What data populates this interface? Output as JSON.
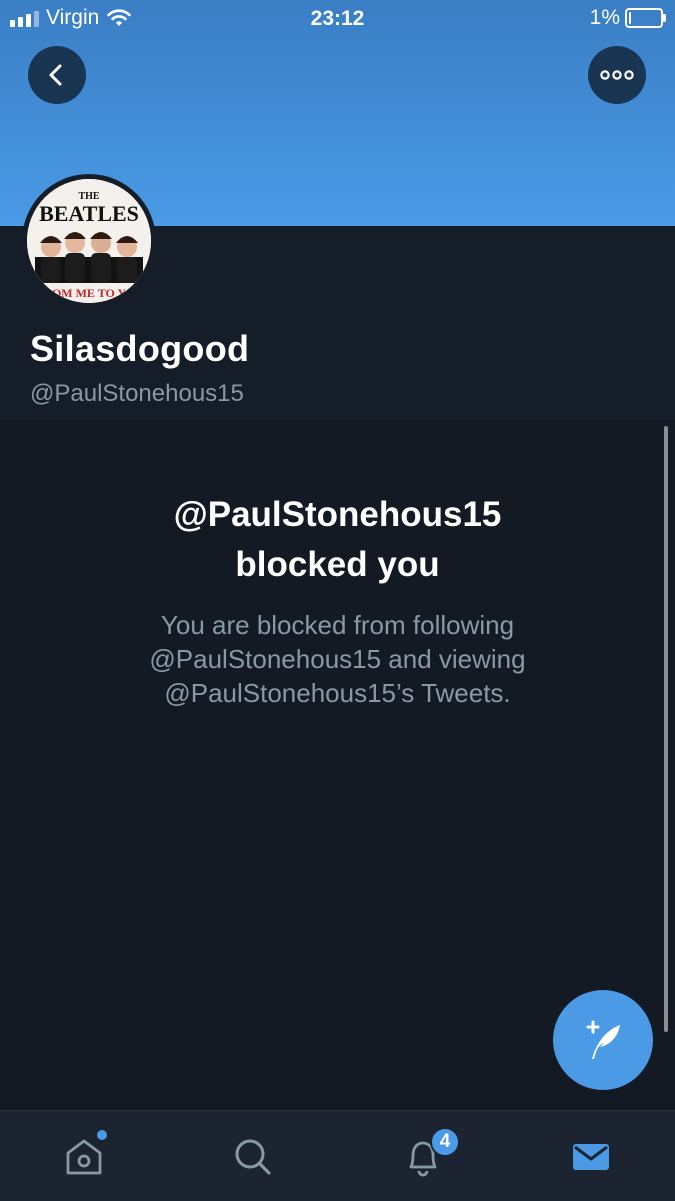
{
  "status_bar": {
    "carrier": "Virgin",
    "time": "23:12",
    "battery_percent": "1%"
  },
  "header": {
    "back_icon": "chevron-left-icon",
    "more_icon": "more-horizontal-icon"
  },
  "profile": {
    "display_name": "Silasdogood",
    "handle": "@PaulStonehous15",
    "avatar": {
      "title": "THE BEATLES",
      "subtitle": "OM ME TO Y"
    }
  },
  "blocked": {
    "title_line1": "@PaulStonehous15",
    "title_line2": "blocked you",
    "desc_line1": "You are blocked from following",
    "desc_line2": "@PaulStonehous15 and viewing",
    "desc_line3": "@PaulStonehous15’s Tweets."
  },
  "fab": {
    "icon": "compose-tweet-icon"
  },
  "tabbar": {
    "notifications_badge": "4",
    "tabs": [
      "home-icon",
      "search-icon",
      "notifications-icon",
      "messages-icon"
    ]
  },
  "colors": {
    "accent": "#4a9ae6",
    "background": "#141a23",
    "muted_text": "#8899a6"
  }
}
